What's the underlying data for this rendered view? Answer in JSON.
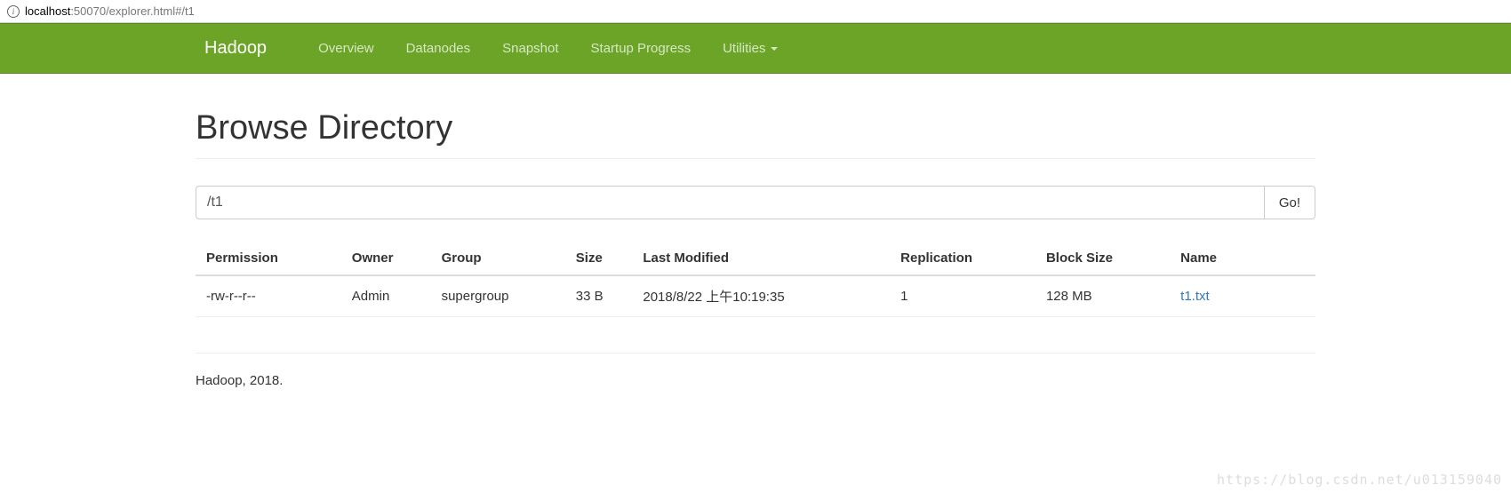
{
  "address": {
    "host": "localhost",
    "rest": ":50070/explorer.html#/t1"
  },
  "navbar": {
    "brand": "Hadoop",
    "items": [
      {
        "label": "Overview"
      },
      {
        "label": "Datanodes"
      },
      {
        "label": "Snapshot"
      },
      {
        "label": "Startup Progress"
      },
      {
        "label": "Utilities",
        "dropdown": true
      }
    ]
  },
  "page": {
    "title": "Browse Directory",
    "path_value": "/t1",
    "go_label": "Go!"
  },
  "table": {
    "headers": {
      "permission": "Permission",
      "owner": "Owner",
      "group": "Group",
      "size": "Size",
      "last_modified": "Last Modified",
      "replication": "Replication",
      "block_size": "Block Size",
      "name": "Name"
    },
    "rows": [
      {
        "permission": "-rw-r--r--",
        "owner": "Admin",
        "group": "supergroup",
        "size": "33 B",
        "last_modified": "2018/8/22 上午10:19:35",
        "replication": "1",
        "block_size": "128 MB",
        "name": "t1.txt"
      }
    ]
  },
  "footer": {
    "text": "Hadoop, 2018."
  },
  "watermark": "https://blog.csdn.net/u013159040"
}
